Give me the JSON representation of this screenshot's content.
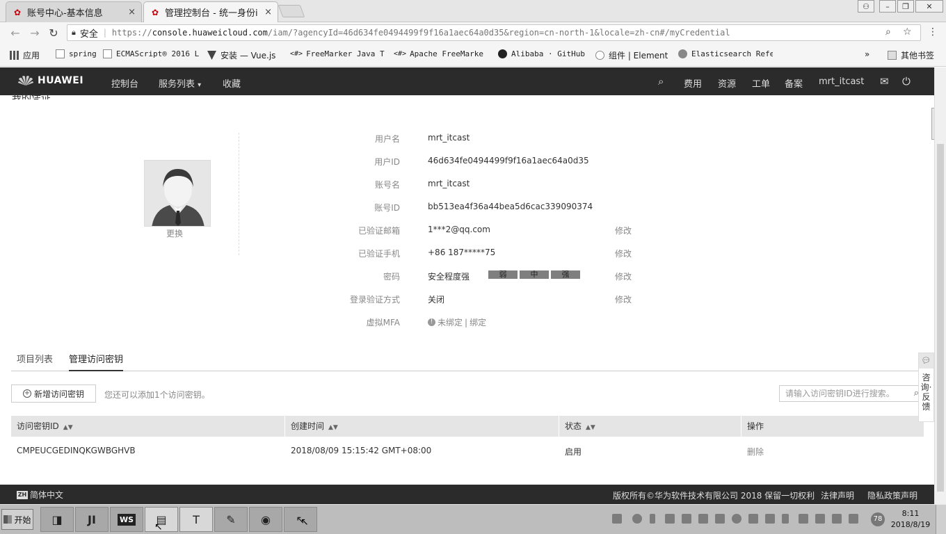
{
  "browser": {
    "tabs": [
      {
        "title": "账号中心-基本信息",
        "active": false
      },
      {
        "title": "管理控制台 - 统一身份i",
        "active": true
      }
    ],
    "address": {
      "secure_label": "安全",
      "url_scheme": "https://",
      "url_host": "console.huaweicloud.com",
      "url_rest": "/iam/?agencyId=46d634fe0494499f9f16a1aec64a0d35&region=cn-north-1&locale=zh-cn#/myCredential"
    },
    "bookmarks": [
      {
        "label": "应用",
        "mono": false
      },
      {
        "label": "spring",
        "mono": true
      },
      {
        "label": "ECMAScript® 2016 L",
        "mono": true
      },
      {
        "label": "安装 — Vue.js",
        "mono": false
      },
      {
        "label": "FreeMarker Java Te",
        "mono": true
      },
      {
        "label": "Apache FreeMarker",
        "mono": true
      },
      {
        "label": "Alibaba · GitHub",
        "mono": true
      },
      {
        "label": "组件 | Element",
        "mono": false
      },
      {
        "label": "Elasticsearch Refe",
        "mono": true
      },
      {
        "label": "其他书签",
        "mono": false
      }
    ],
    "bookmarks_more": "»"
  },
  "header": {
    "logo": "HUAWEI",
    "nav": [
      "控制台",
      "服务列表",
      "收藏"
    ],
    "nav_dropdown_arrow": "▾",
    "right": [
      "费用",
      "资源",
      "工单",
      "备案",
      "mrt_itcast"
    ]
  },
  "profile": {
    "title_cut": "我的凭证",
    "avatar_change": "更换",
    "fields": [
      {
        "label": "用户名",
        "value": "mrt_itcast",
        "edit": ""
      },
      {
        "label": "用户ID",
        "value": "46d634fe0494499f9f16a1aec64a0d35",
        "edit": ""
      },
      {
        "label": "账号名",
        "value": "mrt_itcast",
        "edit": ""
      },
      {
        "label": "账号ID",
        "value": "bb513ea4f36a44bea5d6cac339090374",
        "edit": ""
      },
      {
        "label": "已验证邮箱",
        "value": "1***2@qq.com",
        "edit": "修改"
      },
      {
        "label": "已验证手机",
        "value": "+86 187*****75",
        "edit": "修改"
      },
      {
        "label": "密码",
        "value": "安全程度强",
        "edit": "修改"
      },
      {
        "label": "登录验证方式",
        "value": "关闭",
        "edit": "修改"
      },
      {
        "label": "虚拟MFA",
        "value": "",
        "edit": ""
      }
    ],
    "strength_levels": [
      "弱",
      "中",
      "强"
    ],
    "mfa_status": "未绑定",
    "mfa_sep": "|",
    "mfa_bind": "绑定"
  },
  "content_tabs": [
    {
      "label": "项目列表",
      "active": false
    },
    {
      "label": "管理访问密钥",
      "active": true
    }
  ],
  "toolbar": {
    "add_button": "新增访问密钥",
    "hint": "您还可以添加1个访问密钥。",
    "search_placeholder": "请输入访问密钥ID进行搜索。"
  },
  "table": {
    "columns": [
      "访问密钥ID",
      "创建时间",
      "状态",
      "操作"
    ],
    "rows": [
      {
        "id": "CMPEUCGEDINQKGWBGHVB",
        "created": "2018/08/09 15:15:42 GMT+08:00",
        "status": "启用",
        "action": "删除"
      }
    ]
  },
  "feedback": {
    "label": "咨询·反馈"
  },
  "footer": {
    "lang": "简体中文",
    "copyright": "版权所有©华为软件技术有限公司 2018 保留一切权利",
    "legal": "法律声明",
    "privacy": "隐私政策声明"
  },
  "taskbar": {
    "start": "开始",
    "clock_time": "8:11",
    "clock_date": "2018/8/19",
    "badge": "78"
  },
  "colors": {
    "header_bg": "#2b2b2b",
    "strength_bar": "#7f7f7f",
    "brand_red": "#c7000b"
  }
}
